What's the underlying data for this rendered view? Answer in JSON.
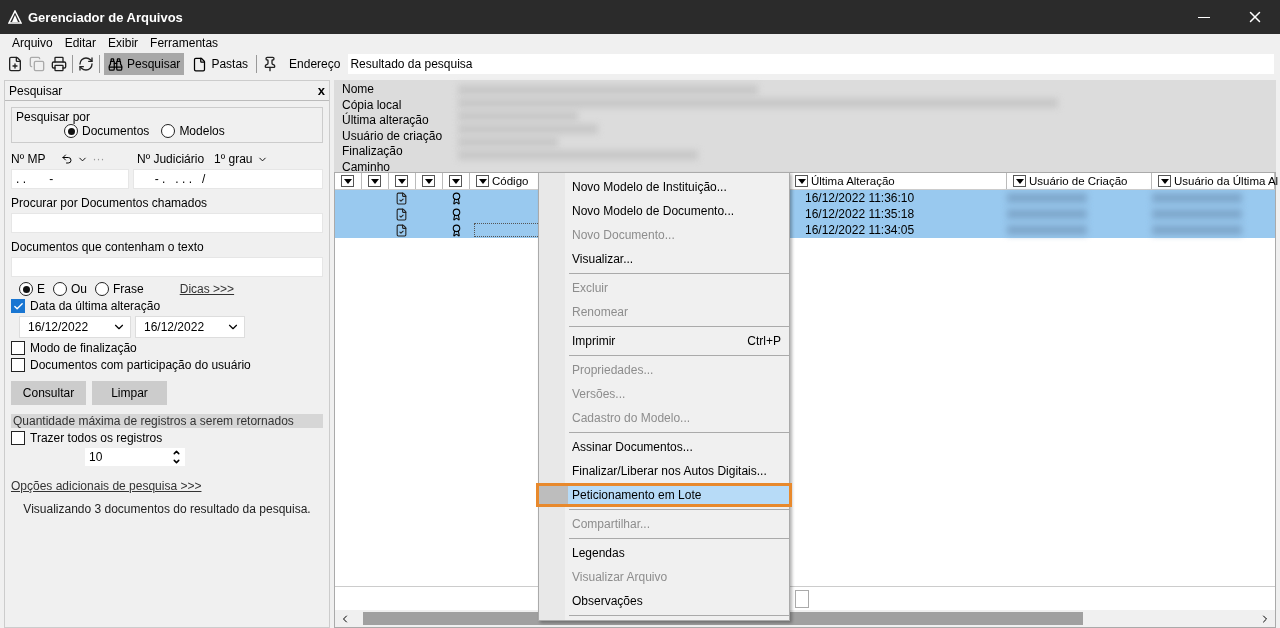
{
  "window": {
    "title": "Gerenciador de Arquivos"
  },
  "menu_bar": [
    "Arquivo",
    "Editar",
    "Exibir",
    "Ferramentas"
  ],
  "toolbar": {
    "tools": [
      {
        "kind": "new",
        "disabled": false
      },
      {
        "kind": "copy",
        "disabled": true
      },
      {
        "kind": "print",
        "disabled": false
      },
      {
        "kind": "separator"
      },
      {
        "kind": "refresh",
        "disabled": false
      },
      {
        "kind": "separator"
      },
      {
        "kind": "search",
        "label": "Pesquisar",
        "selected": true
      },
      {
        "kind": "folders",
        "label": "Pastas",
        "selected": false
      },
      {
        "kind": "separator"
      },
      {
        "kind": "pin",
        "disabled": false
      }
    ],
    "address_label": "Endereço",
    "address_value": "Resultado da pesquisa"
  },
  "search_panel": {
    "title": "Pesquisar",
    "close": "x",
    "search_by": {
      "label": "Pesquisar por",
      "options": [
        {
          "label": "Documentos",
          "selected": true
        },
        {
          "label": "Modelos",
          "selected": false
        }
      ]
    },
    "mp": {
      "label": "Nº MP",
      "more": "···",
      "value": ". .       -"
    },
    "judicial": {
      "label": "Nº Judiciário",
      "grade": "1º grau",
      "value": "- .   . . .   /"
    },
    "name_field": {
      "label": "Procurar por Documentos chamados"
    },
    "text_field": {
      "label": "Documentos que contenham o texto"
    },
    "logic": [
      {
        "label": "E",
        "selected": true
      },
      {
        "label": "Ou",
        "selected": false
      },
      {
        "label": "Frase",
        "selected": false
      }
    ],
    "tips_link": "Dicas >>>",
    "date_filter": {
      "label": "Data da última alteração",
      "checked": true,
      "from": "16/12/2022",
      "to": "16/12/2022"
    },
    "options": [
      {
        "label": "Modo de finalização",
        "checked": false
      },
      {
        "label": "Documentos com participação do usuário",
        "checked": false
      }
    ],
    "buttons": [
      "Consultar",
      "Limpar"
    ],
    "limit": {
      "header": "Quantidade máxima de registros a serem retornados",
      "all": {
        "label": "Trazer todos os registros",
        "checked": false
      },
      "value": "10"
    },
    "more_link": "Opções adicionais de pesquisa >>>",
    "status": "Visualizando 3 documentos do resultado da pesquisa."
  },
  "details": {
    "labels": [
      "Nome",
      "Cópia local",
      "Última alteração",
      "Usuário de criação",
      "Finalização",
      "Caminho"
    ]
  },
  "table": {
    "columns": [
      {
        "kind": "filter"
      },
      {
        "kind": "filter"
      },
      {
        "kind": "filter"
      },
      {
        "kind": "filter"
      },
      {
        "kind": "filter"
      },
      {
        "kind": "labeled",
        "label": "Código"
      },
      {
        "kind": "labeled",
        "label": "Última Alteração"
      },
      {
        "kind": "labeled",
        "label": "Usuário de Criação"
      },
      {
        "kind": "labeled",
        "label": "Usuário da Última Al"
      }
    ],
    "rows": [
      {
        "selected": true,
        "modified": "16/12/2022 11:36:10",
        "focused": false
      },
      {
        "selected": true,
        "modified": "16/12/2022 11:35:18",
        "focused": false
      },
      {
        "selected": true,
        "modified": "16/12/2022 11:34:05",
        "focused": true
      }
    ]
  },
  "context_menu": [
    {
      "kind": "item",
      "label": "Novo Modelo de Instituição...",
      "disabled": false,
      "selected": false
    },
    {
      "kind": "item",
      "label": "Novo Modelo de Documento...",
      "disabled": false,
      "selected": false
    },
    {
      "kind": "item",
      "label": "Novo Documento...",
      "disabled": true,
      "selected": false
    },
    {
      "kind": "item",
      "label": "Visualizar...",
      "disabled": false,
      "selected": false
    },
    {
      "kind": "separator"
    },
    {
      "kind": "item",
      "label": "Excluir",
      "disabled": true,
      "selected": false
    },
    {
      "kind": "item",
      "label": "Renomear",
      "disabled": true,
      "selected": false
    },
    {
      "kind": "separator"
    },
    {
      "kind": "item",
      "label": "Imprimir",
      "shortcut": "Ctrl+P",
      "disabled": false,
      "selected": false
    },
    {
      "kind": "separator"
    },
    {
      "kind": "item",
      "label": "Propriedades...",
      "disabled": true,
      "selected": false
    },
    {
      "kind": "item",
      "label": "Versões...",
      "disabled": true,
      "selected": false
    },
    {
      "kind": "item",
      "label": "Cadastro do Modelo...",
      "disabled": true,
      "selected": false
    },
    {
      "kind": "separator"
    },
    {
      "kind": "item",
      "label": "Assinar Documentos...",
      "disabled": false,
      "selected": false
    },
    {
      "kind": "item",
      "label": "Finalizar/Liberar nos Autos Digitais...",
      "disabled": false,
      "selected": false
    },
    {
      "kind": "item",
      "label": "Peticionamento em Lote",
      "disabled": false,
      "selected": true
    },
    {
      "kind": "separator"
    },
    {
      "kind": "item",
      "label": "Compartilhar...",
      "disabled": true,
      "selected": false
    },
    {
      "kind": "separator"
    },
    {
      "kind": "item",
      "label": "Legendas",
      "disabled": false,
      "selected": false
    },
    {
      "kind": "item",
      "label": "Visualizar Arquivo",
      "disabled": true,
      "selected": false
    },
    {
      "kind": "item",
      "label": "Observações",
      "disabled": false,
      "selected": false
    },
    {
      "kind": "separator"
    }
  ]
}
